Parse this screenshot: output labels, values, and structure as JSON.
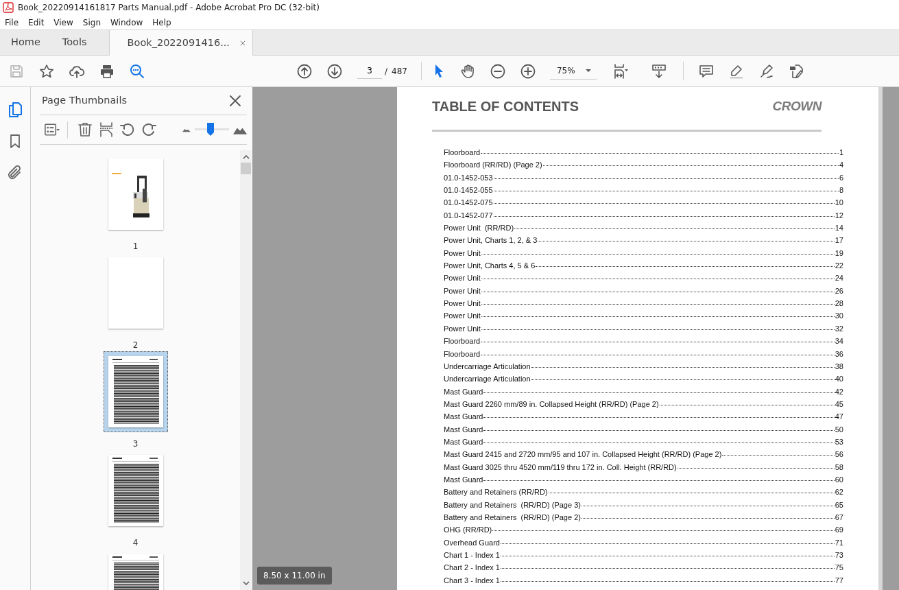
{
  "window": {
    "title": "Book_20220914161817 Parts Manual.pdf - Adobe Acrobat Pro DC (32-bit)"
  },
  "menu": [
    "File",
    "Edit",
    "View",
    "Sign",
    "Window",
    "Help"
  ],
  "tabs": [
    {
      "label": "Home",
      "selected": false
    },
    {
      "label": "Tools",
      "selected": false
    },
    {
      "label": "Book_2022091416...",
      "selected": true
    }
  ],
  "toolbar": {
    "save": {
      "disabled": true
    },
    "page": "3",
    "page_separator": "/",
    "page_count": "487",
    "zoom": "75%",
    "tools": [
      {
        "kind": "select",
        "selected": true
      },
      {
        "kind": "hand",
        "selected": false
      }
    ]
  },
  "rail": [
    {
      "kind": "pages",
      "selected": true
    },
    {
      "kind": "bookmarks",
      "selected": false
    },
    {
      "kind": "attachments",
      "selected": false
    }
  ],
  "panel": {
    "title": "Page Thumbnails",
    "thumbnail_size": {
      "level": 0.45
    },
    "thumbnails": [
      {
        "kind": "cover",
        "label": "1",
        "selected": false
      },
      {
        "kind": "blank",
        "label": "2",
        "selected": false
      },
      {
        "kind": "contents",
        "label": "3",
        "selected": true
      },
      {
        "kind": "contents",
        "label": "4",
        "selected": false
      },
      {
        "kind": "contents",
        "selected": false
      }
    ]
  },
  "page_size": "8.50 x 11.00 in",
  "document": {
    "title": "TABLE OF CONTENTS",
    "logo": "CROWN",
    "entries": [
      {
        "title": "Floorboard",
        "page": "1"
      },
      {
        "title": "Floorboard (RR/RD) (Page 2)",
        "page": "4"
      },
      {
        "title": "01.0-1452-053",
        "page": "6"
      },
      {
        "title": "01.0-1452-055",
        "page": "8"
      },
      {
        "title": "01.0-1452-075",
        "page": "10"
      },
      {
        "title": "01.0-1452-077",
        "page": "12"
      },
      {
        "title": "Power Unit  (RR/RD)",
        "page": "14"
      },
      {
        "title": "Power Unit, Charts 1, 2, & 3",
        "page": "17"
      },
      {
        "title": "Power Unit",
        "page": "19"
      },
      {
        "title": "Power Unit, Charts 4, 5 & 6",
        "page": "22"
      },
      {
        "title": "Power Unit",
        "page": "24"
      },
      {
        "title": "Power Unit",
        "page": "26"
      },
      {
        "title": "Power Unit",
        "page": "28"
      },
      {
        "title": "Power Unit",
        "page": "30"
      },
      {
        "title": "Power Unit",
        "page": "32"
      },
      {
        "title": "Floorboard",
        "page": "34"
      },
      {
        "title": "Floorboard",
        "page": "36"
      },
      {
        "title": "Undercarriage Articulation",
        "page": "38"
      },
      {
        "title": "Undercarriage Articulation",
        "page": "40"
      },
      {
        "title": "Mast Guard",
        "page": "42"
      },
      {
        "title": "Mast Guard 2260 mm/89 in. Collapsed Height (RR/RD) (Page 2)",
        "page": "45"
      },
      {
        "title": "Mast Guard",
        "page": "47"
      },
      {
        "title": "Mast Guard",
        "page": "50"
      },
      {
        "title": "Mast Guard",
        "page": "53"
      },
      {
        "title": "Mast Guard 2415 and 2720 mm/95 and 107 in. Collapsed Height (RR/RD) (Page 2)",
        "page": "56"
      },
      {
        "title": "Mast Guard 3025 thru 4520 mm/119 thru 172 in. Coll. Height (RR/RD)",
        "page": "58"
      },
      {
        "title": "Mast Guard",
        "page": "60"
      },
      {
        "title": "Battery and Retainers (RR/RD)",
        "page": "62"
      },
      {
        "title": "Battery and Retainers  (RR/RD) (Page 3)",
        "page": "65"
      },
      {
        "title": "Battery and Retainers  (RR/RD) (Page 2)",
        "page": "67"
      },
      {
        "title": "OHG (RR/RD)",
        "page": "69"
      },
      {
        "title": "Overhead Guard",
        "page": "71"
      },
      {
        "title": "Chart 1 - Index 1",
        "page": "73"
      },
      {
        "title": "Chart 2 - Index 1",
        "page": "75"
      },
      {
        "title": "Chart 3 - Index 1",
        "page": "77"
      }
    ]
  }
}
